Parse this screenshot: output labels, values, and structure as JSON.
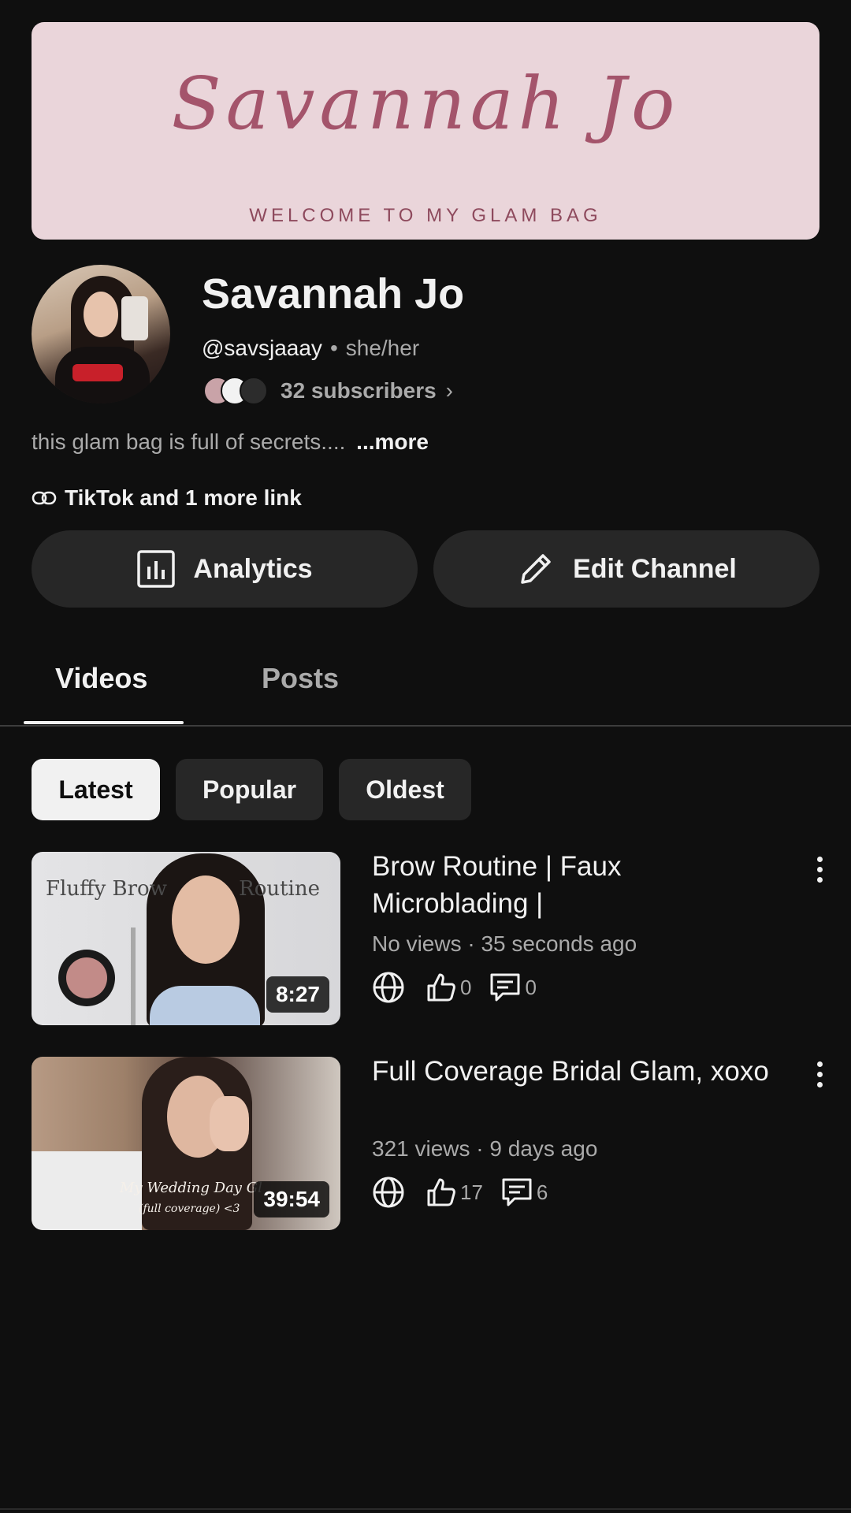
{
  "banner": {
    "script_text": "Savannah Jo",
    "tagline": "WELCOME TO MY GLAM BAG"
  },
  "channel": {
    "name": "Savannah Jo",
    "handle": "@savsjaaay",
    "separator": "•",
    "pronouns": "she/her",
    "subscribers": "32 subscribers",
    "description": "this glam bag is full of secrets....",
    "more_label": "...more",
    "links_label": "TikTok and 1 more link"
  },
  "actions": {
    "analytics_label": "Analytics",
    "edit_label": "Edit Channel"
  },
  "tabs": [
    {
      "label": "Videos",
      "active": true
    },
    {
      "label": "Posts",
      "active": false
    }
  ],
  "chips": [
    {
      "label": "Latest",
      "selected": true
    },
    {
      "label": "Popular",
      "selected": false
    },
    {
      "label": "Oldest",
      "selected": false
    }
  ],
  "videos": [
    {
      "title": "Brow Routine | Faux Microblading |",
      "meta": "No views · 35 seconds ago",
      "duration": "8:27",
      "likes": "0",
      "comments": "0",
      "thumb_text_left": "Fluffy Brow",
      "thumb_text_right": "Routine"
    },
    {
      "title": "Full Coverage Bridal Glam, xoxo",
      "meta": "321 views · 9 days ago",
      "duration": "39:54",
      "likes": "17",
      "comments": "6",
      "thumb_caption_1": "My Wedding Day Gl",
      "thumb_caption_2": "(full coverage) <3"
    }
  ],
  "icons": {
    "link": "link-icon",
    "analytics": "bar-chart-icon",
    "edit": "pencil-icon",
    "visibility": "globe-icon",
    "like": "thumbs-up-icon",
    "comment": "comment-icon",
    "more": "kebab-menu-icon"
  },
  "colors": {
    "background": "#0f0f0f",
    "banner": "#ead5da",
    "banner_text": "#a4546b",
    "button_bg": "#272727",
    "chip_selected": "#f1f1f1",
    "secondary_text": "#aaaaaa"
  }
}
